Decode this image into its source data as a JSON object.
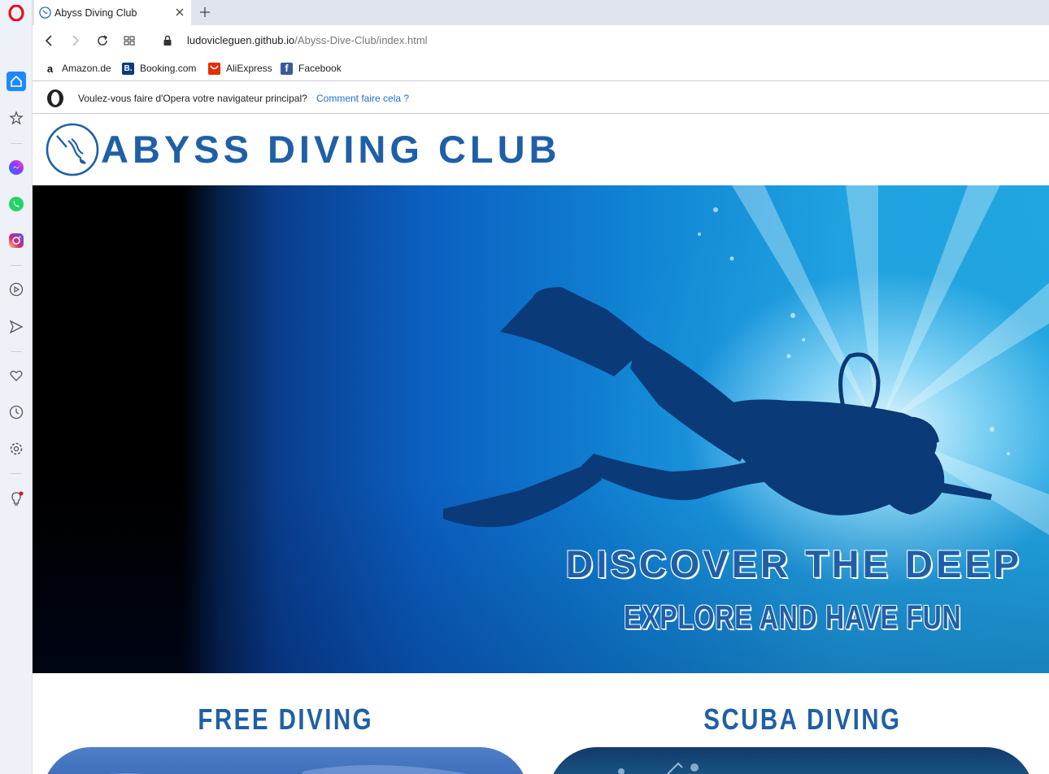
{
  "browser": {
    "tab": {
      "title": "Abyss Diving Club"
    },
    "address": {
      "host": "ludovicleguen.github.io",
      "path": "/Abyss-Dive-Club/index.html"
    },
    "bookmarks": [
      {
        "label": "Amazon.de",
        "icon": "amazon-icon",
        "color": "#111111"
      },
      {
        "label": "Booking.com",
        "icon": "booking-icon",
        "color": "#0c3b7c"
      },
      {
        "label": "AliExpress",
        "icon": "aliexpress-icon",
        "color": "#e62e04"
      },
      {
        "label": "Facebook",
        "icon": "facebook-icon",
        "color": "#1877f2"
      }
    ],
    "infobar": {
      "text": "Voulez-vous faire d'Opera votre navigateur principal?",
      "link": "Comment faire cela ?"
    },
    "sidebar": [
      "home-icon",
      "bookmarks-icon",
      "messenger-icon",
      "whatsapp-icon",
      "instagram-icon",
      "player-icon",
      "send-icon",
      "heart-icon",
      "history-icon",
      "settings-icon",
      "tips-icon"
    ]
  },
  "site": {
    "title": "ABYSS DIVING CLUB",
    "hero": {
      "headline": "DISCOVER THE DEEP",
      "subline": "EXPLORE AND HAVE FUN"
    },
    "sections": [
      {
        "title": "FREE DIVING"
      },
      {
        "title": "SCUBA DIVING"
      }
    ],
    "colors": {
      "brand": "#1f5fa8",
      "accent_link": "#1e6fd4",
      "opera_red": "#e0121f"
    }
  }
}
